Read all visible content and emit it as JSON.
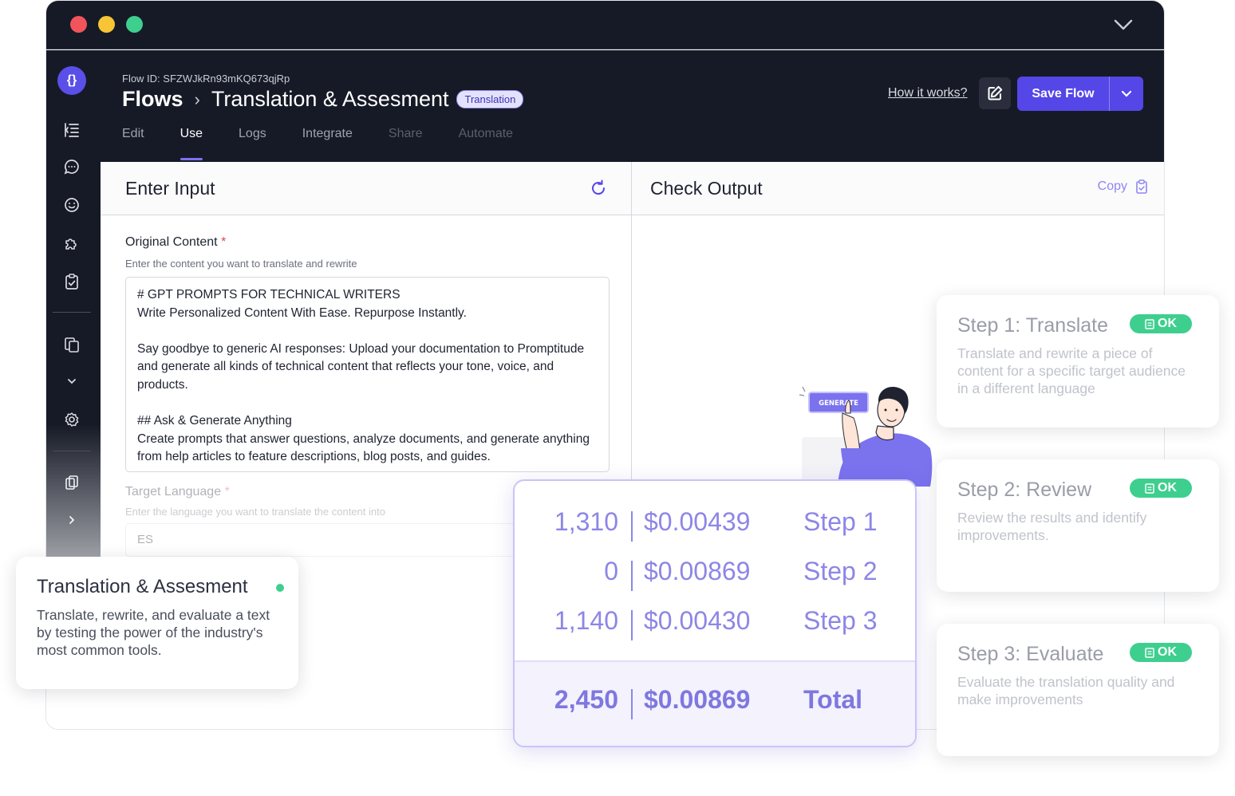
{
  "header": {
    "flow_id": "Flow ID: SFZWJkRn93mKQ673qjRp",
    "breadcrumb_root": "Flows",
    "breadcrumb_separator": "›",
    "breadcrumb_page": "Translation & Assesment",
    "badge": "Translation",
    "tabs": [
      {
        "label": "Edit",
        "state": "default"
      },
      {
        "label": "Use",
        "state": "active"
      },
      {
        "label": "Logs",
        "state": "default"
      },
      {
        "label": "Integrate",
        "state": "default"
      },
      {
        "label": "Share",
        "state": "disabled"
      },
      {
        "label": "Automate",
        "state": "disabled"
      }
    ],
    "how_link": "How it works?",
    "save_label": "Save Flow"
  },
  "sidebar": {
    "logo_text": "{}",
    "icons": [
      "flow-list-icon",
      "chat-icon",
      "smile-icon",
      "puzzle-icon",
      "clipboard-check-icon",
      "copy-doc-icon",
      "chevron-down-icon",
      "settings-icon",
      "docs-icon",
      "chevron-right-icon"
    ]
  },
  "input_panel": {
    "title": "Enter Input",
    "original_label": "Original Content",
    "required_mark": "*",
    "original_help": "Enter the content you want to translate and rewrite",
    "original_value": "# GPT PROMPTS FOR TECHNICAL WRITERS\nWrite Personalized Content With Ease. Repurpose Instantly.\n\nSay goodbye to generic AI responses: Upload your documentation to Promptitude and generate all kinds of technical content that reflects your tone, voice, and products.\n\n## Ask & Generate Anything\nCreate prompts that answer questions, analyze documents, and generate anything from help articles to feature descriptions, blog posts, and guides.",
    "language_label": "Target Language",
    "language_help": "Enter the language you want to translate the content into",
    "language_value": "ES"
  },
  "output_panel": {
    "title": "Check Output",
    "copy_label": "Copy",
    "generate_label": "GENERATE"
  },
  "info_card": {
    "title": "Translation & Assesment",
    "description": "Translate, rewrite, and evaluate a text by testing the power of the industry's most common tools."
  },
  "cost_card": {
    "rows": [
      {
        "tokens": "1,310",
        "cost": "$0.00439",
        "step": "Step 1"
      },
      {
        "tokens": "0",
        "cost": "$0.00869",
        "step": "Step 2"
      },
      {
        "tokens": "1,140",
        "cost": "$0.00430",
        "step": "Step 3"
      }
    ],
    "total": {
      "tokens": "2,450",
      "cost": "$0.00869",
      "step": "Total"
    }
  },
  "steps": [
    {
      "title": "Step 1: Translate",
      "status": "OK",
      "description": "Translate and rewrite a piece of content for a specific target audience in a different language"
    },
    {
      "title": "Step 2: Review",
      "status": "OK",
      "description": "Review the results and identify improvements."
    },
    {
      "title": "Step 3: Evaluate",
      "status": "OK",
      "description": "Evaluate the translation quality and make improvements"
    }
  ],
  "colors": {
    "brand": "#5546e8",
    "dark_bg": "#161a26",
    "ok_green": "#3ecf8e",
    "accent_lavender": "#8d86e6"
  }
}
